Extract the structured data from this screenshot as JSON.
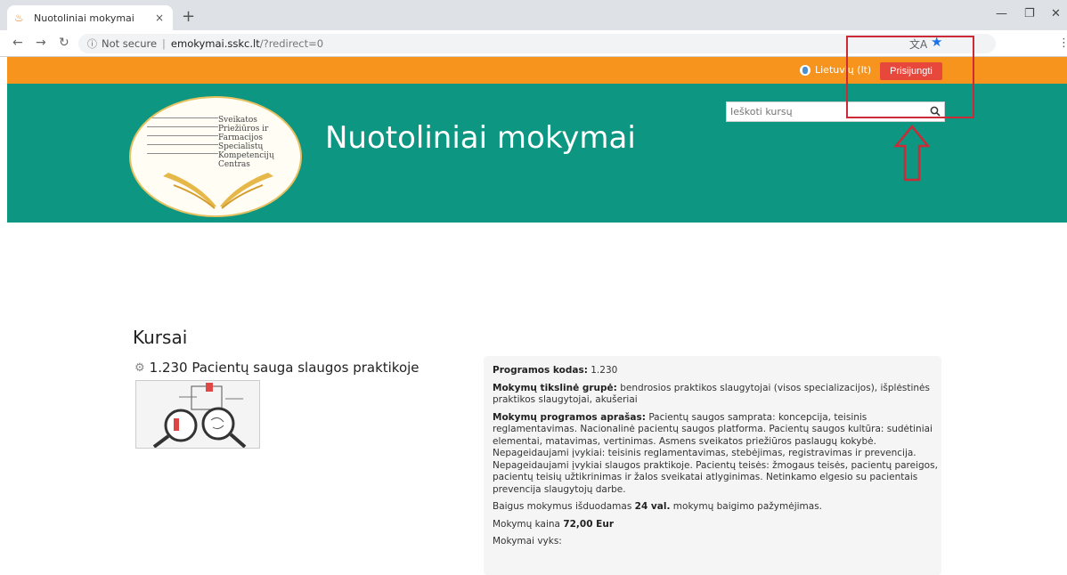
{
  "browser": {
    "tab_title": "Nuotoliniai mokymai",
    "tab_close": "×",
    "new_tab": "+",
    "security_label": "Not secure",
    "url_host": "emokymai.sskc.lt",
    "url_path": "/?redirect=0"
  },
  "site": {
    "language": "Lietuvių (lt)",
    "login": "Prisijungti",
    "title": "Nuotoliniai mokymai",
    "search_placeholder": "Ieškoti kursų",
    "logo_lines": [
      "Sveikatos",
      "Priežiūros ir",
      "Farmacijos",
      "Specialistų",
      "Kompetencijų",
      "Centras"
    ]
  },
  "content": {
    "section_title": "Kursai",
    "course": {
      "name": "1.230 Pacientų sauga slaugos praktikoje",
      "code_label": "Programos kodas:",
      "code": "1.230",
      "group_label": "Mokymų tikslinė grupė:",
      "group": "bendrosios praktikos slaugytojai (visos specializacijos), išplėstinės praktikos slaugytojai, akušeriai",
      "desc_label": "Mokymų programos aprašas:",
      "desc": "Pacientų saugos samprata: koncepcija, teisinis reglamentavimas. Nacionalinė pacientų saugos platforma. Pacientų saugos kultūra: sudėtiniai elementai, matavimas, vertinimas. Asmens sveikatos priežiūros paslaugų kokybė. Nepageidaujami įvykiai: teisinis reglamentavimas, stebėjimas, registravimas ir prevencija. Nepageidaujami įvykiai slaugos praktikoje. Pacientų teisės: žmogaus teisės, pacientų pareigos, pacientų teisių užtikrinimas ir žalos sveikatai atlyginimas. Netinkamo elgesio su pacientais prevencija slaugytojų darbe.",
      "cert_prefix": "Baigus mokymus išduodamas",
      "cert_hours": "24 val.",
      "cert_suffix": "mokymų baigimo pažymėjimas.",
      "price_label": "Mokymų kaina",
      "price": "72,00 Eur",
      "venue_label": "Mokymai vyks:"
    }
  },
  "colors": {
    "orange_strip": "#f7941d",
    "hero_teal": "#0d9681",
    "login_red": "#e8483c",
    "annotation_red": "#cc2a36"
  }
}
